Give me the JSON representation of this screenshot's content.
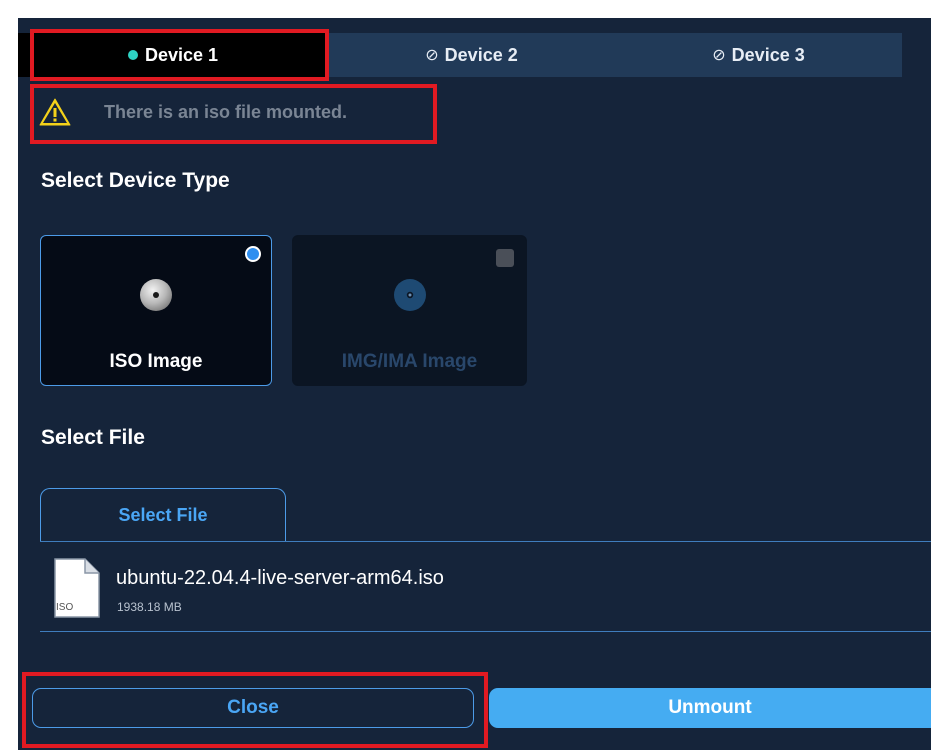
{
  "tabs": [
    {
      "label": "Device 1",
      "status": "active",
      "status_color": "#2ed3c4"
    },
    {
      "label": "Device 2",
      "status": "disabled",
      "icon": "ban-icon"
    },
    {
      "label": "Device 3",
      "status": "disabled",
      "icon": "ban-icon"
    }
  ],
  "warning": {
    "icon": "warning-triangle-icon",
    "text": "There is an iso file mounted."
  },
  "device_type": {
    "title": "Select Device Type",
    "options": [
      {
        "label": "ISO Image",
        "selected": true,
        "icon": "disc-icon"
      },
      {
        "label": "IMG/IMA Image",
        "selected": false,
        "icon": "disc-icon"
      }
    ]
  },
  "file_select": {
    "title": "Select File",
    "button_label": "Select File",
    "file": {
      "icon_label": "ISO",
      "name": "ubuntu-22.04.4-live-server-arm64.iso",
      "size": "1938.18 MB"
    }
  },
  "actions": {
    "close_label": "Close",
    "unmount_label": "Unmount"
  },
  "colors": {
    "panel": "#15243a",
    "accent": "#4aa6f5",
    "highlight": "#e11a22"
  }
}
